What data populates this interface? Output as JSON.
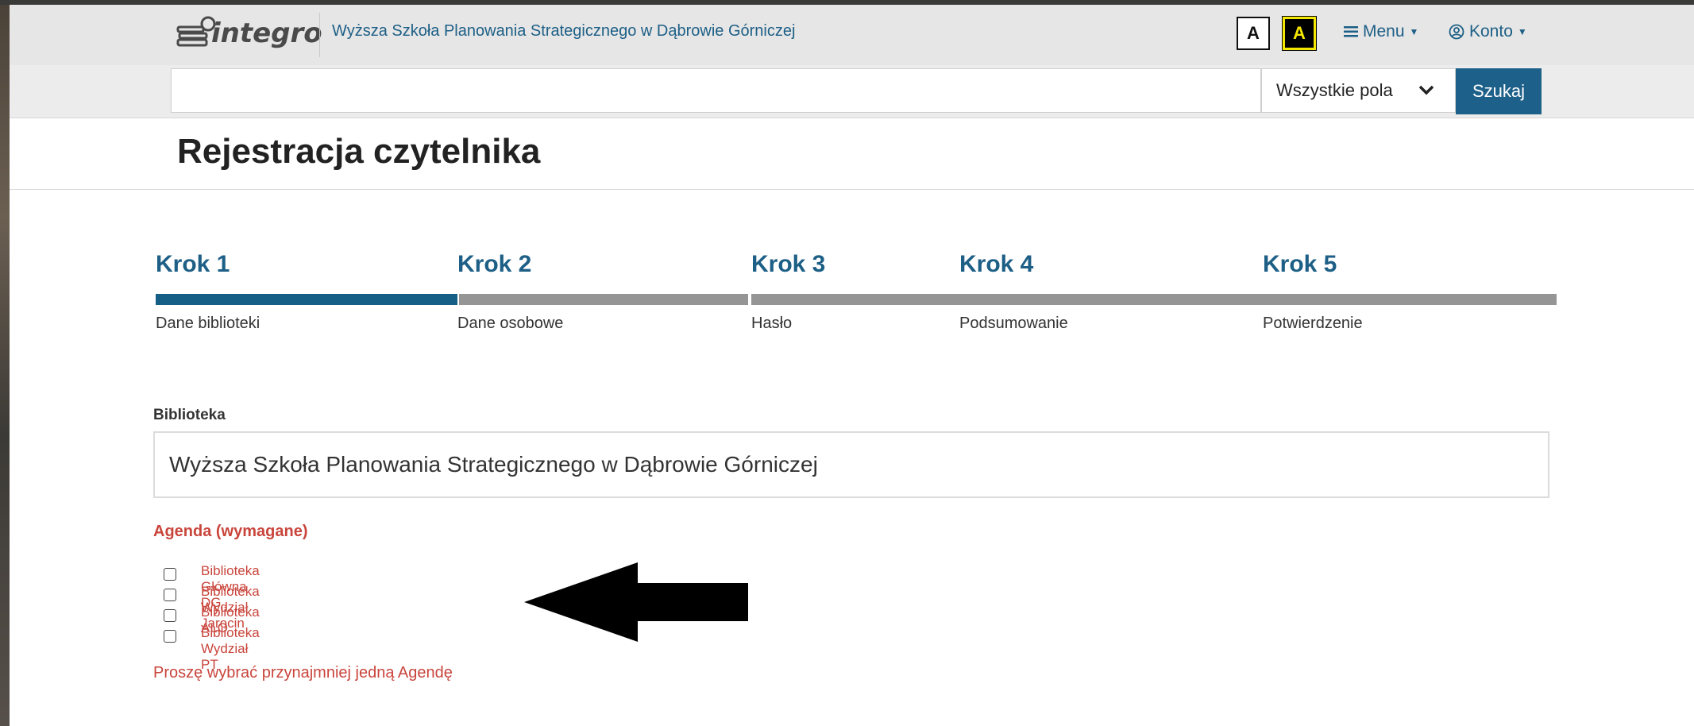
{
  "header": {
    "logo_text": "integro",
    "site_title": "Wyższa Szkoła Planowania Strategicznego w Dąbrowie Górniczej",
    "contrast_normal": "A",
    "contrast_high": "A",
    "menu_label": "Menu",
    "account_label": "Konto"
  },
  "search": {
    "value": "",
    "field_select": "Wszystkie pola",
    "button_label": "Szukaj"
  },
  "page": {
    "title": "Rejestracja czytelnika"
  },
  "steps": [
    {
      "label": "Krok 1",
      "desc": "Dane biblioteki",
      "active": true
    },
    {
      "label": "Krok 2",
      "desc": "Dane osobowe",
      "active": false
    },
    {
      "label": "Krok 3",
      "desc": "Hasło",
      "active": false
    },
    {
      "label": "Krok 4",
      "desc": "Podsumowanie",
      "active": false
    },
    {
      "label": "Krok 5",
      "desc": "Potwierdzenie",
      "active": false
    }
  ],
  "form": {
    "library_label": "Biblioteka",
    "library_value": "Wyższa Szkoła Planowania Strategicznego w Dąbrowie Górniczej",
    "agenda_label": "Agenda (wymagane)",
    "agendas": [
      "Biblioteka Główna DG",
      "Biblioteka Wydział Jarocin",
      "Biblioteka ALO",
      "Biblioteka Wydział PT"
    ],
    "error": "Proszę wybrać przynajmniej jedną Agendę"
  },
  "colors": {
    "primary": "#1d5f86",
    "error": "#c9453c",
    "step_inactive": "#959595"
  }
}
